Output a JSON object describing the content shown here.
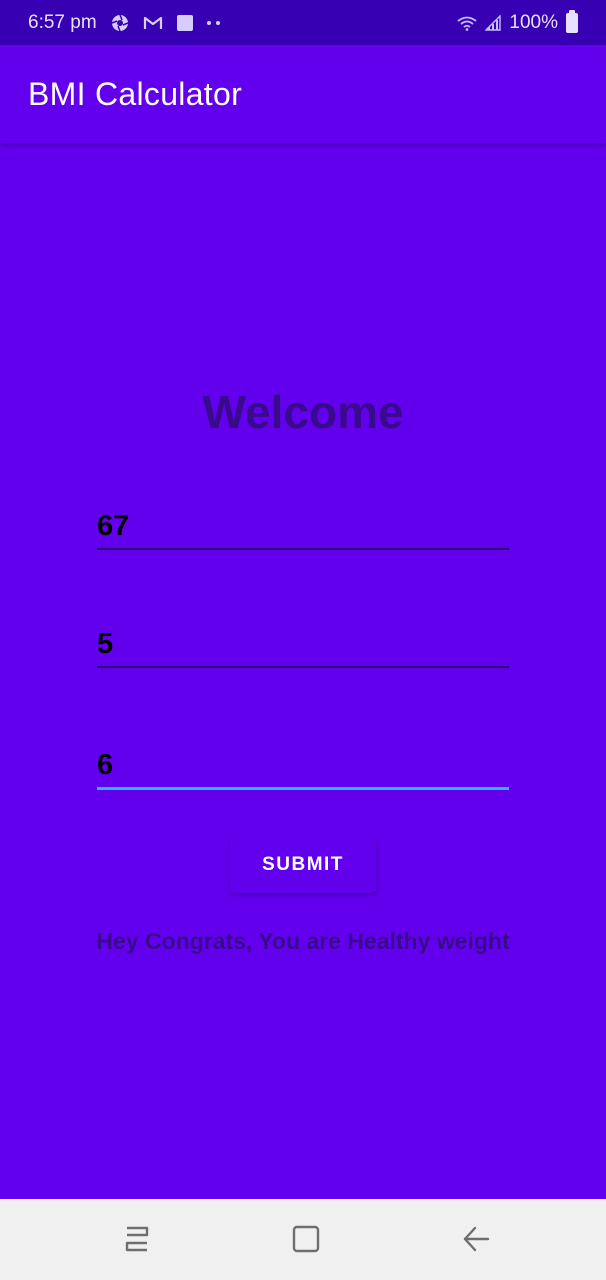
{
  "status_bar": {
    "time": "6:57 pm",
    "battery": "100%",
    "icons": [
      "aperture-icon",
      "gmail-icon",
      "notification-square-icon",
      "more-dots-icon",
      "wifi-icon",
      "signal-icon",
      "battery-icon"
    ]
  },
  "app_bar": {
    "title": "BMI Calculator"
  },
  "main": {
    "welcome": "Welcome",
    "weight_value": "67",
    "height_feet_value": "5",
    "height_inches_value": "6",
    "submit_label": "SUBMIT",
    "result_text": "Hey Congrats, You are Healthy weight"
  },
  "nav_bar": {
    "icons": [
      "recent-apps-icon",
      "home-icon",
      "back-icon"
    ]
  },
  "colors": {
    "primary": "#6200EE",
    "primary_dark": "#3700B3",
    "text_dark_purple": "#3A0A8C",
    "focus_accent": "#2BB6F5"
  }
}
